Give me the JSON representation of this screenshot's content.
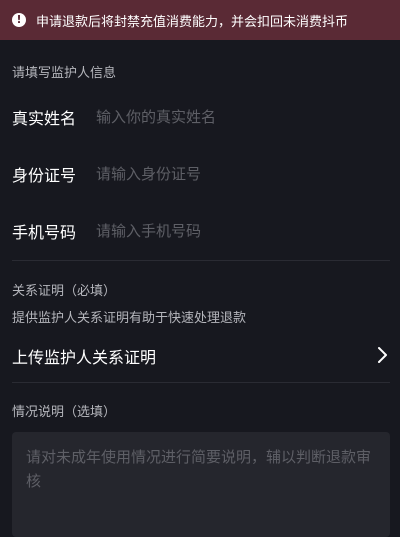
{
  "warning": {
    "icon": "exclamation-circle-icon",
    "text": "申请退款后将封禁充值消费能力，并会扣回未消费抖币"
  },
  "guardian_section": {
    "title": "请填写监护人信息",
    "fields": [
      {
        "label": "真实姓名",
        "placeholder": "输入你的真实姓名",
        "value": ""
      },
      {
        "label": "身份证号",
        "placeholder": "请输入身份证号",
        "value": ""
      },
      {
        "label": "手机号码",
        "placeholder": "请输入手机号码",
        "value": ""
      }
    ]
  },
  "relation_section": {
    "title": "关系证明（必填）",
    "hint": "提供监护人关系证明有助于快速处理退款",
    "upload_label": "上传监护人关系证明",
    "upload_icon": "chevron-right-icon"
  },
  "situation_section": {
    "title": "情况说明（选填）",
    "placeholder": "请对未成年使用情况进行简要说明，辅以判断退款审核"
  },
  "colors": {
    "background": "#17181f",
    "banner": "#5a2a35",
    "placeholder": "#5e5f66",
    "secondary_text": "#b5b6bc",
    "textarea_bg": "#25262d"
  }
}
